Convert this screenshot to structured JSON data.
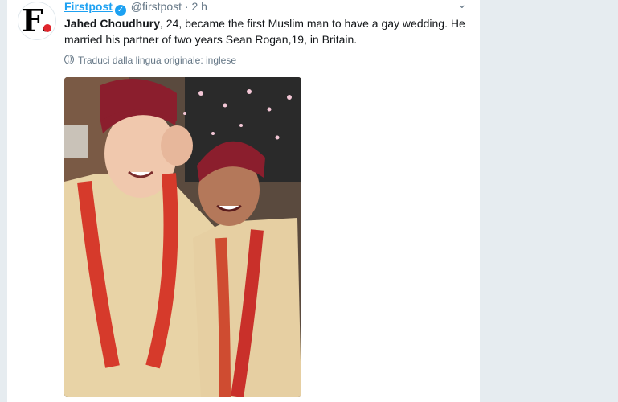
{
  "tweet": {
    "avatar_letter": "F.",
    "display_name": "Firstpost",
    "verified_icon": "verified-badge-icon",
    "handle": "@firstpost",
    "separator": "·",
    "time": "2 h",
    "text_bold": "Jahed Choudhury",
    "text_rest": ", 24, became the first Muslim man to have a gay wedding. He married his partner of two years Sean Rogan,19, in Britain.",
    "translate_label": "Traduci dalla lingua originale: inglese",
    "menu_icon": "chevron-down-icon"
  },
  "colors": {
    "link": "#1da1f2",
    "muted": "#657786",
    "text": "#14171a",
    "brand_dot": "#e0262d"
  }
}
